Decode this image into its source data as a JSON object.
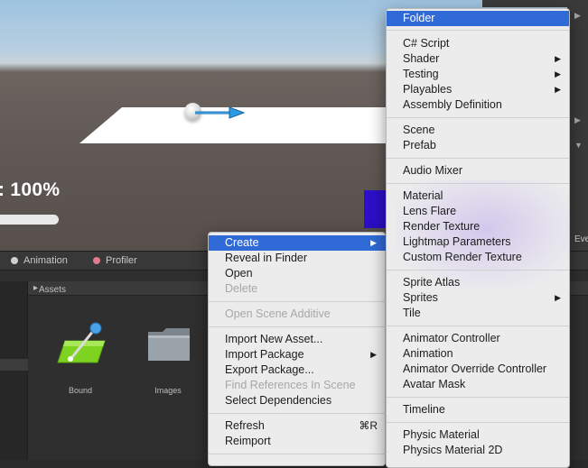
{
  "scene": {
    "progress_label": ": 100%",
    "progress_value": 1.0,
    "right_panel_label": "Eve"
  },
  "tabs": [
    {
      "label": "Animation",
      "icon": "animation-icon"
    },
    {
      "label": "Profiler",
      "icon": "profiler-icon"
    }
  ],
  "project": {
    "breadcrumb": "Assets",
    "assets": [
      {
        "label": "Bound",
        "icon": "bound-asset-icon"
      },
      {
        "label": "Images",
        "icon": "folder-icon"
      }
    ]
  },
  "context_menu": {
    "items": [
      {
        "label": "Create",
        "has_submenu": true,
        "highlighted": true
      },
      {
        "label": "Reveal in Finder"
      },
      {
        "label": "Open"
      },
      {
        "label": "Delete",
        "disabled": true
      },
      {
        "label": "Open Scene Additive",
        "disabled": true
      },
      {
        "label": "Import New Asset..."
      },
      {
        "label": "Import Package",
        "has_submenu": true
      },
      {
        "label": "Export Package..."
      },
      {
        "label": "Find References In Scene",
        "disabled": true
      },
      {
        "label": "Select Dependencies"
      },
      {
        "label": "Refresh",
        "shortcut": "⌘R"
      },
      {
        "label": "Reimport"
      }
    ]
  },
  "create_submenu": {
    "items": [
      {
        "label": "Folder",
        "highlighted": true
      },
      {
        "label": "C# Script"
      },
      {
        "label": "Shader",
        "has_submenu": true
      },
      {
        "label": "Testing",
        "has_submenu": true
      },
      {
        "label": "Playables",
        "has_submenu": true
      },
      {
        "label": "Assembly Definition"
      },
      {
        "label": "Scene"
      },
      {
        "label": "Prefab"
      },
      {
        "label": "Audio Mixer"
      },
      {
        "label": "Material"
      },
      {
        "label": "Lens Flare"
      },
      {
        "label": "Render Texture"
      },
      {
        "label": "Lightmap Parameters"
      },
      {
        "label": "Custom Render Texture"
      },
      {
        "label": "Sprite Atlas"
      },
      {
        "label": "Sprites",
        "has_submenu": true
      },
      {
        "label": "Tile"
      },
      {
        "label": "Animator Controller"
      },
      {
        "label": "Animation"
      },
      {
        "label": "Animator Override Controller"
      },
      {
        "label": "Avatar Mask"
      },
      {
        "label": "Timeline"
      },
      {
        "label": "Physic Material"
      },
      {
        "label": "Physics Material 2D"
      }
    ]
  },
  "colors": {
    "menu_highlight": "#2f6ad6",
    "menu_background": "#ececec",
    "gizmo_arrow": "#1f8fd6",
    "blue_cube": "#2d0fc9"
  }
}
